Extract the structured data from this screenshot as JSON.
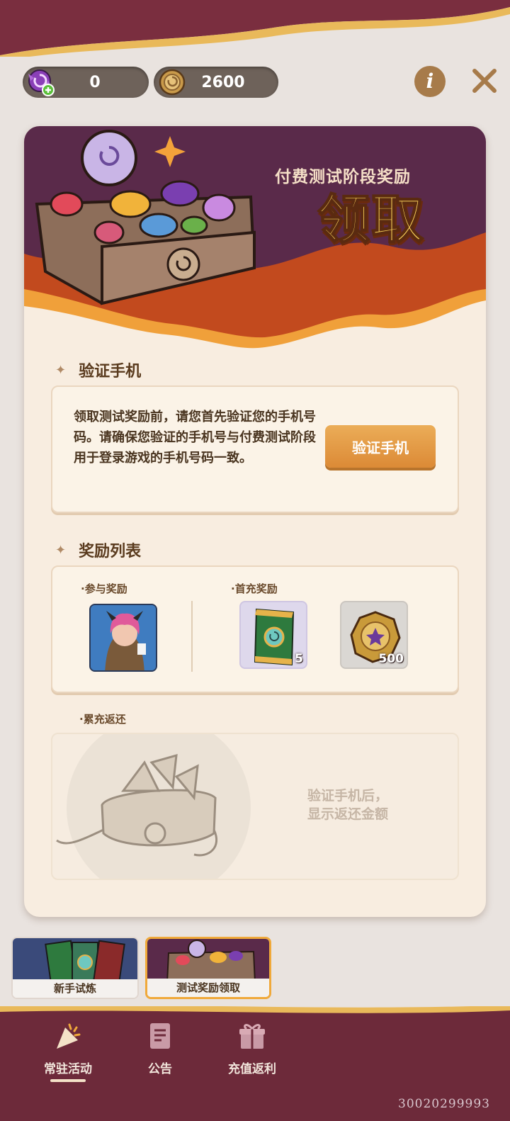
{
  "currency": {
    "candy_amount": "0",
    "coin_amount": "2600"
  },
  "header": {
    "info_label": "i"
  },
  "banner": {
    "subtitle": "付费测试阶段奖励",
    "title": "领取"
  },
  "verify_section": {
    "title": "验证手机",
    "description": "领取测试奖励前，请您首先验证您的手机号码。请确保您验证的手机号与付费测试阶段用于登录游戏的手机号码一致。",
    "button_label": "验证手机"
  },
  "rewards_section": {
    "title": "奖励列表",
    "participation_label": "·参与奖励",
    "first_recharge_label": "·首充奖励",
    "items": [
      {
        "icon": "character-portrait",
        "count": ""
      },
      {
        "icon": "card-pack",
        "count": "5"
      },
      {
        "icon": "gold-coin",
        "count": "500"
      }
    ]
  },
  "refund_section": {
    "label": "·累充返还",
    "message_line1": "验证手机后，",
    "message_line2": "显示返还金额"
  },
  "sub_tabs": [
    {
      "label": "新手试炼",
      "active": false
    },
    {
      "label": "测试奖励领取",
      "active": true
    }
  ],
  "bottom_nav": [
    {
      "label": "常驻活动",
      "icon": "party-popper-icon",
      "active": true
    },
    {
      "label": "公告",
      "icon": "document-icon",
      "active": false
    },
    {
      "label": "充值返利",
      "icon": "gift-icon",
      "active": false
    }
  ],
  "watermark": "30020299993",
  "colors": {
    "accent_orange": "#dc8a36",
    "banner_purple": "#5a2a4a",
    "nav_bg": "#6d2a3a",
    "card_bg": "#f8ede0"
  }
}
